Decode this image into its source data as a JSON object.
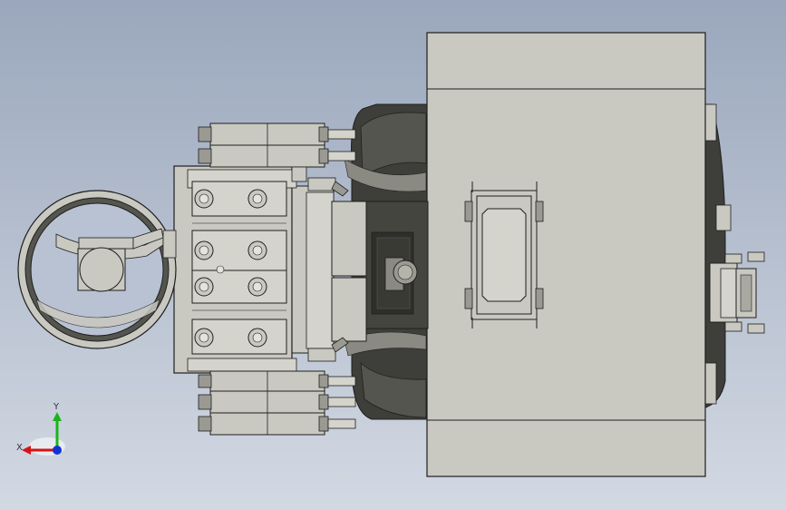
{
  "viewport": {
    "background_top": "#9aa7bc",
    "background_bottom": "#d3d9e3"
  },
  "colors": {
    "part_fill": "#c9c9c1",
    "part_fill_light": "#d4d4cc",
    "part_dark": "#3e3e3a",
    "part_mid": "#6b6b64",
    "edge": "#1f1f1f"
  },
  "triad": {
    "x_label": "X",
    "y_label": "Y",
    "x_color": "#d41414",
    "y_color": "#19b419",
    "z_color": "#1432d4"
  }
}
